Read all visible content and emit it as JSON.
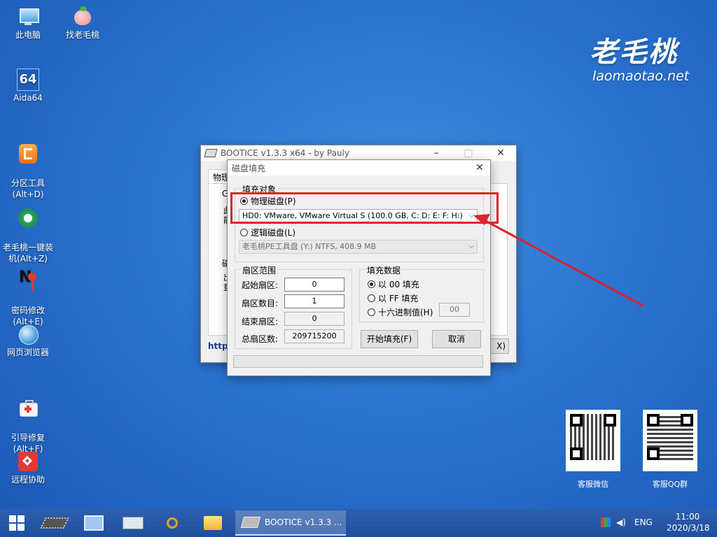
{
  "desktop_icons": [
    {
      "label": "此电脑",
      "icon": "computer-icon"
    },
    {
      "label": "找老毛桃",
      "icon": "peach-icon"
    },
    {
      "label": "Aida64",
      "icon": "aida64-icon",
      "badge": "64"
    },
    {
      "label": "分区工具\n(Alt+D)",
      "icon": "partition-tool-icon"
    },
    {
      "label": "老毛桃一键装\n机(Alt+Z)",
      "icon": "install-icon"
    },
    {
      "label": "密码修改\n(Alt+E)",
      "icon": "password-icon"
    },
    {
      "label": "网页浏览器",
      "icon": "browser-icon"
    },
    {
      "label": "引导修复\n(Alt+F)",
      "icon": "boot-repair-icon"
    },
    {
      "label": "远程协助",
      "icon": "remote-assist-icon"
    }
  ],
  "brand": {
    "logo": "老毛桃",
    "url": "laomaotao.net"
  },
  "qr": [
    {
      "label": "客服微信"
    },
    {
      "label": "客服QQ群"
    }
  ],
  "bootice": {
    "title": "BOOTICE v1.3.3 x64 - by Pauly",
    "tab": "物理",
    "g_label": "G",
    "frag1": "此",
    "frag2": "能",
    "frag3": "磁",
    "frag4": "出",
    "frag5": "童",
    "url_fragment": "http:",
    "exit_fragment": "X)"
  },
  "dialog": {
    "title": "磁盘填充",
    "target_group": "填充对象",
    "physical_label": "物理磁盘(P)",
    "physical_value": "HD0: VMware, VMware Virtual S (100.0 GB, C: D: E: F: H:)",
    "logical_label": "逻辑磁盘(L)",
    "logical_value": "老毛桃PE工具盘 (Y:)  NTFS, 408.9 MB",
    "sector_group": "扇区范围",
    "start_label": "起始扇区:",
    "start_value": "0",
    "count_label": "扇区数目:",
    "count_value": "1",
    "end_label": "结束扇区:",
    "end_value": "0",
    "total_label": "总扇区数:",
    "total_value": "209715200",
    "fill_group": "填充数据",
    "fill_00": "以 00 填充",
    "fill_ff": "以 FF 填充",
    "fill_hex": "十六进制值(H)",
    "hex_value": "00",
    "start_btn": "开始填充(F)",
    "cancel_btn": "取消"
  },
  "taskbar": {
    "task_label": "BOOTICE v1.3.3 ...",
    "lang": "ENG",
    "time": "11:00",
    "date": "2020/3/18"
  },
  "colors": {
    "highlight": "#e0202a",
    "desktop": "#2a73cf",
    "taskbar": "#244fa0"
  }
}
